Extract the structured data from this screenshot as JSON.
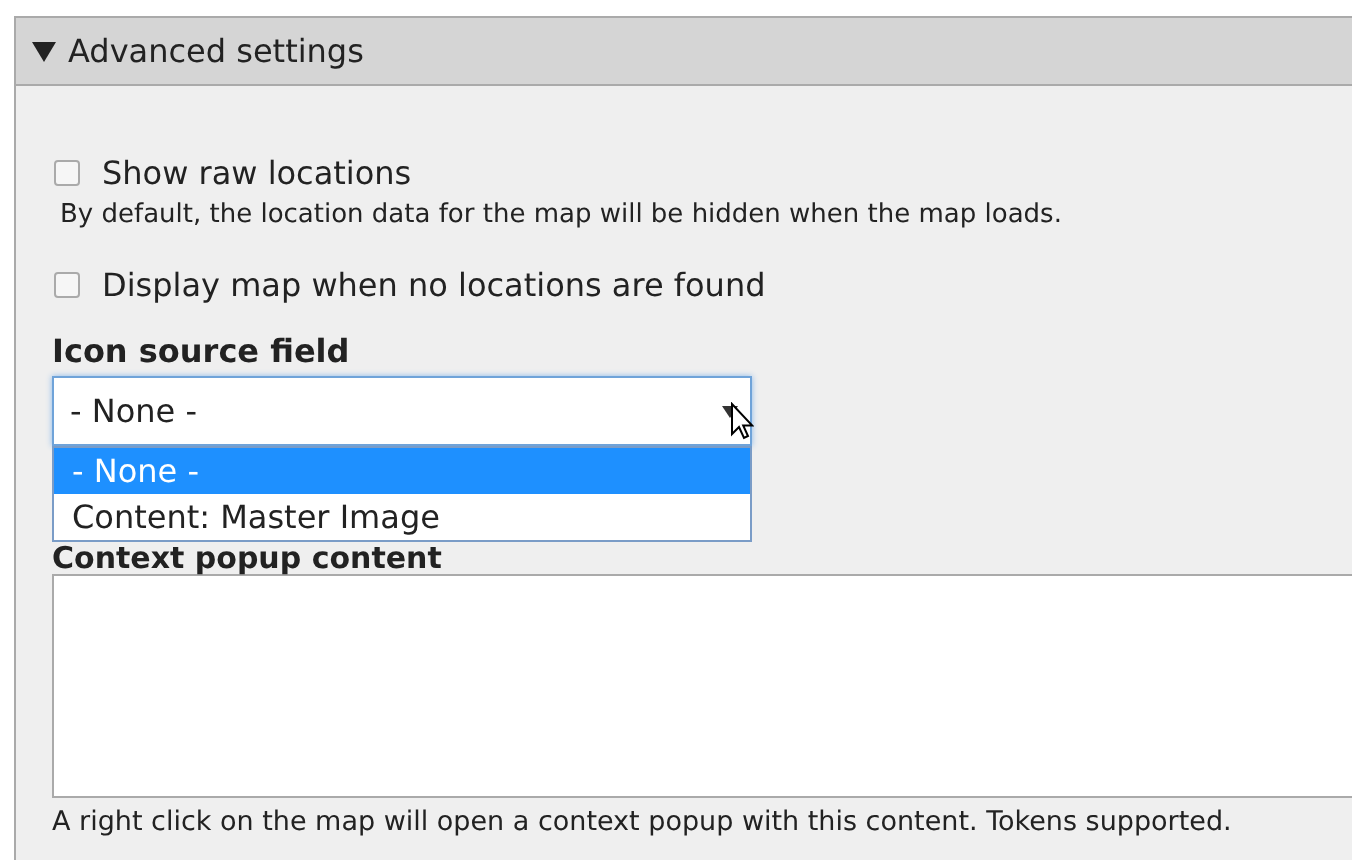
{
  "panel": {
    "title": "Advanced settings",
    "expanded": true
  },
  "checkboxes": [
    {
      "label": "Show raw locations",
      "checked": false,
      "description": "By default, the location data for the map will be hidden when the map loads."
    },
    {
      "label": "Display map when no locations are found",
      "checked": false
    }
  ],
  "icon_source": {
    "label": "Icon source field",
    "value": "- None -",
    "expanded": true,
    "options": [
      {
        "label": "- None -",
        "selected": true
      },
      {
        "label": "Content: Master Image",
        "selected": false
      }
    ]
  },
  "context_popup": {
    "label": "Context popup content",
    "description": "A right click on the map will open a context popup with this content. Tokens supported."
  }
}
